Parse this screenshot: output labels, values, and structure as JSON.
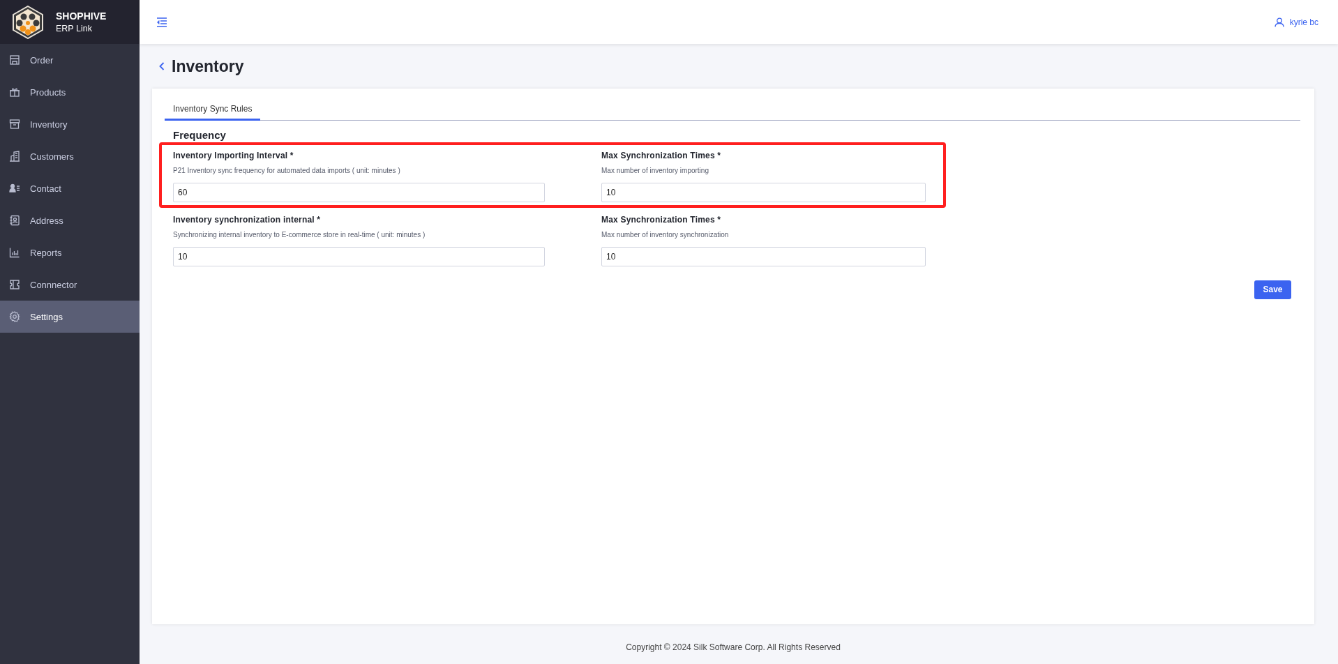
{
  "brand": {
    "name": "SHOPHIVE",
    "subtitle": "ERP Link"
  },
  "sidebar": {
    "items": [
      {
        "label": "Order",
        "selected": false
      },
      {
        "label": "Products",
        "selected": false
      },
      {
        "label": "Inventory",
        "selected": false
      },
      {
        "label": "Customers",
        "selected": false
      },
      {
        "label": "Contact",
        "selected": false
      },
      {
        "label": "Address",
        "selected": false
      },
      {
        "label": "Reports",
        "selected": false
      },
      {
        "label": "Connnector",
        "selected": false
      },
      {
        "label": "Settings",
        "selected": true
      }
    ]
  },
  "header": {
    "user": "kyrie bc"
  },
  "page": {
    "title": "Inventory"
  },
  "tabs": [
    {
      "label": "Inventory Sync Rules",
      "selected": true
    }
  ],
  "section": {
    "title": "Frequency"
  },
  "rows": [
    {
      "highlighted": true,
      "fields": [
        {
          "label": "Inventory Importing Interval *",
          "description": "P21 Inventory sync frequency for automated data imports ( unit: minutes )",
          "value": "60"
        },
        {
          "label": "Max Synchronization Times *",
          "description": "Max number of inventory importing",
          "value": "10"
        }
      ]
    },
    {
      "highlighted": false,
      "fields": [
        {
          "label": "Inventory synchronization internal *",
          "description": "Synchronizing internal inventory to E-commerce store in real-time ( unit: minutes )",
          "value": "10"
        },
        {
          "label": "Max Synchronization Times *",
          "description": "Max number of inventory synchronization",
          "value": "10"
        }
      ]
    }
  ],
  "save_button": "Save",
  "footer": "Copyright © 2024 Silk Software Corp. All Rights Reserved"
}
